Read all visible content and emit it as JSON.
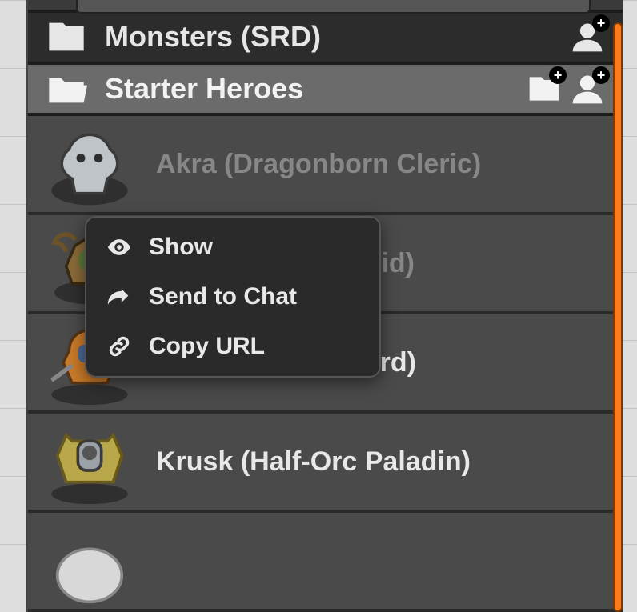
{
  "folders": {
    "monsters": {
      "label": "Monsters (SRD)"
    },
    "starter": {
      "label": "Starter Heroes"
    }
  },
  "heroes": [
    {
      "name": "Akra (Dragonborn Cleric)"
    },
    {
      "name": "Aoth (Human Druid)"
    },
    {
      "name": "Beiro (Half-Elf Bard)"
    },
    {
      "name": "Krusk (Half-Orc Paladin)"
    },
    {
      "name": ""
    }
  ],
  "context_menu": {
    "show": "Show",
    "send": "Send to Chat",
    "copy": "Copy URL"
  }
}
